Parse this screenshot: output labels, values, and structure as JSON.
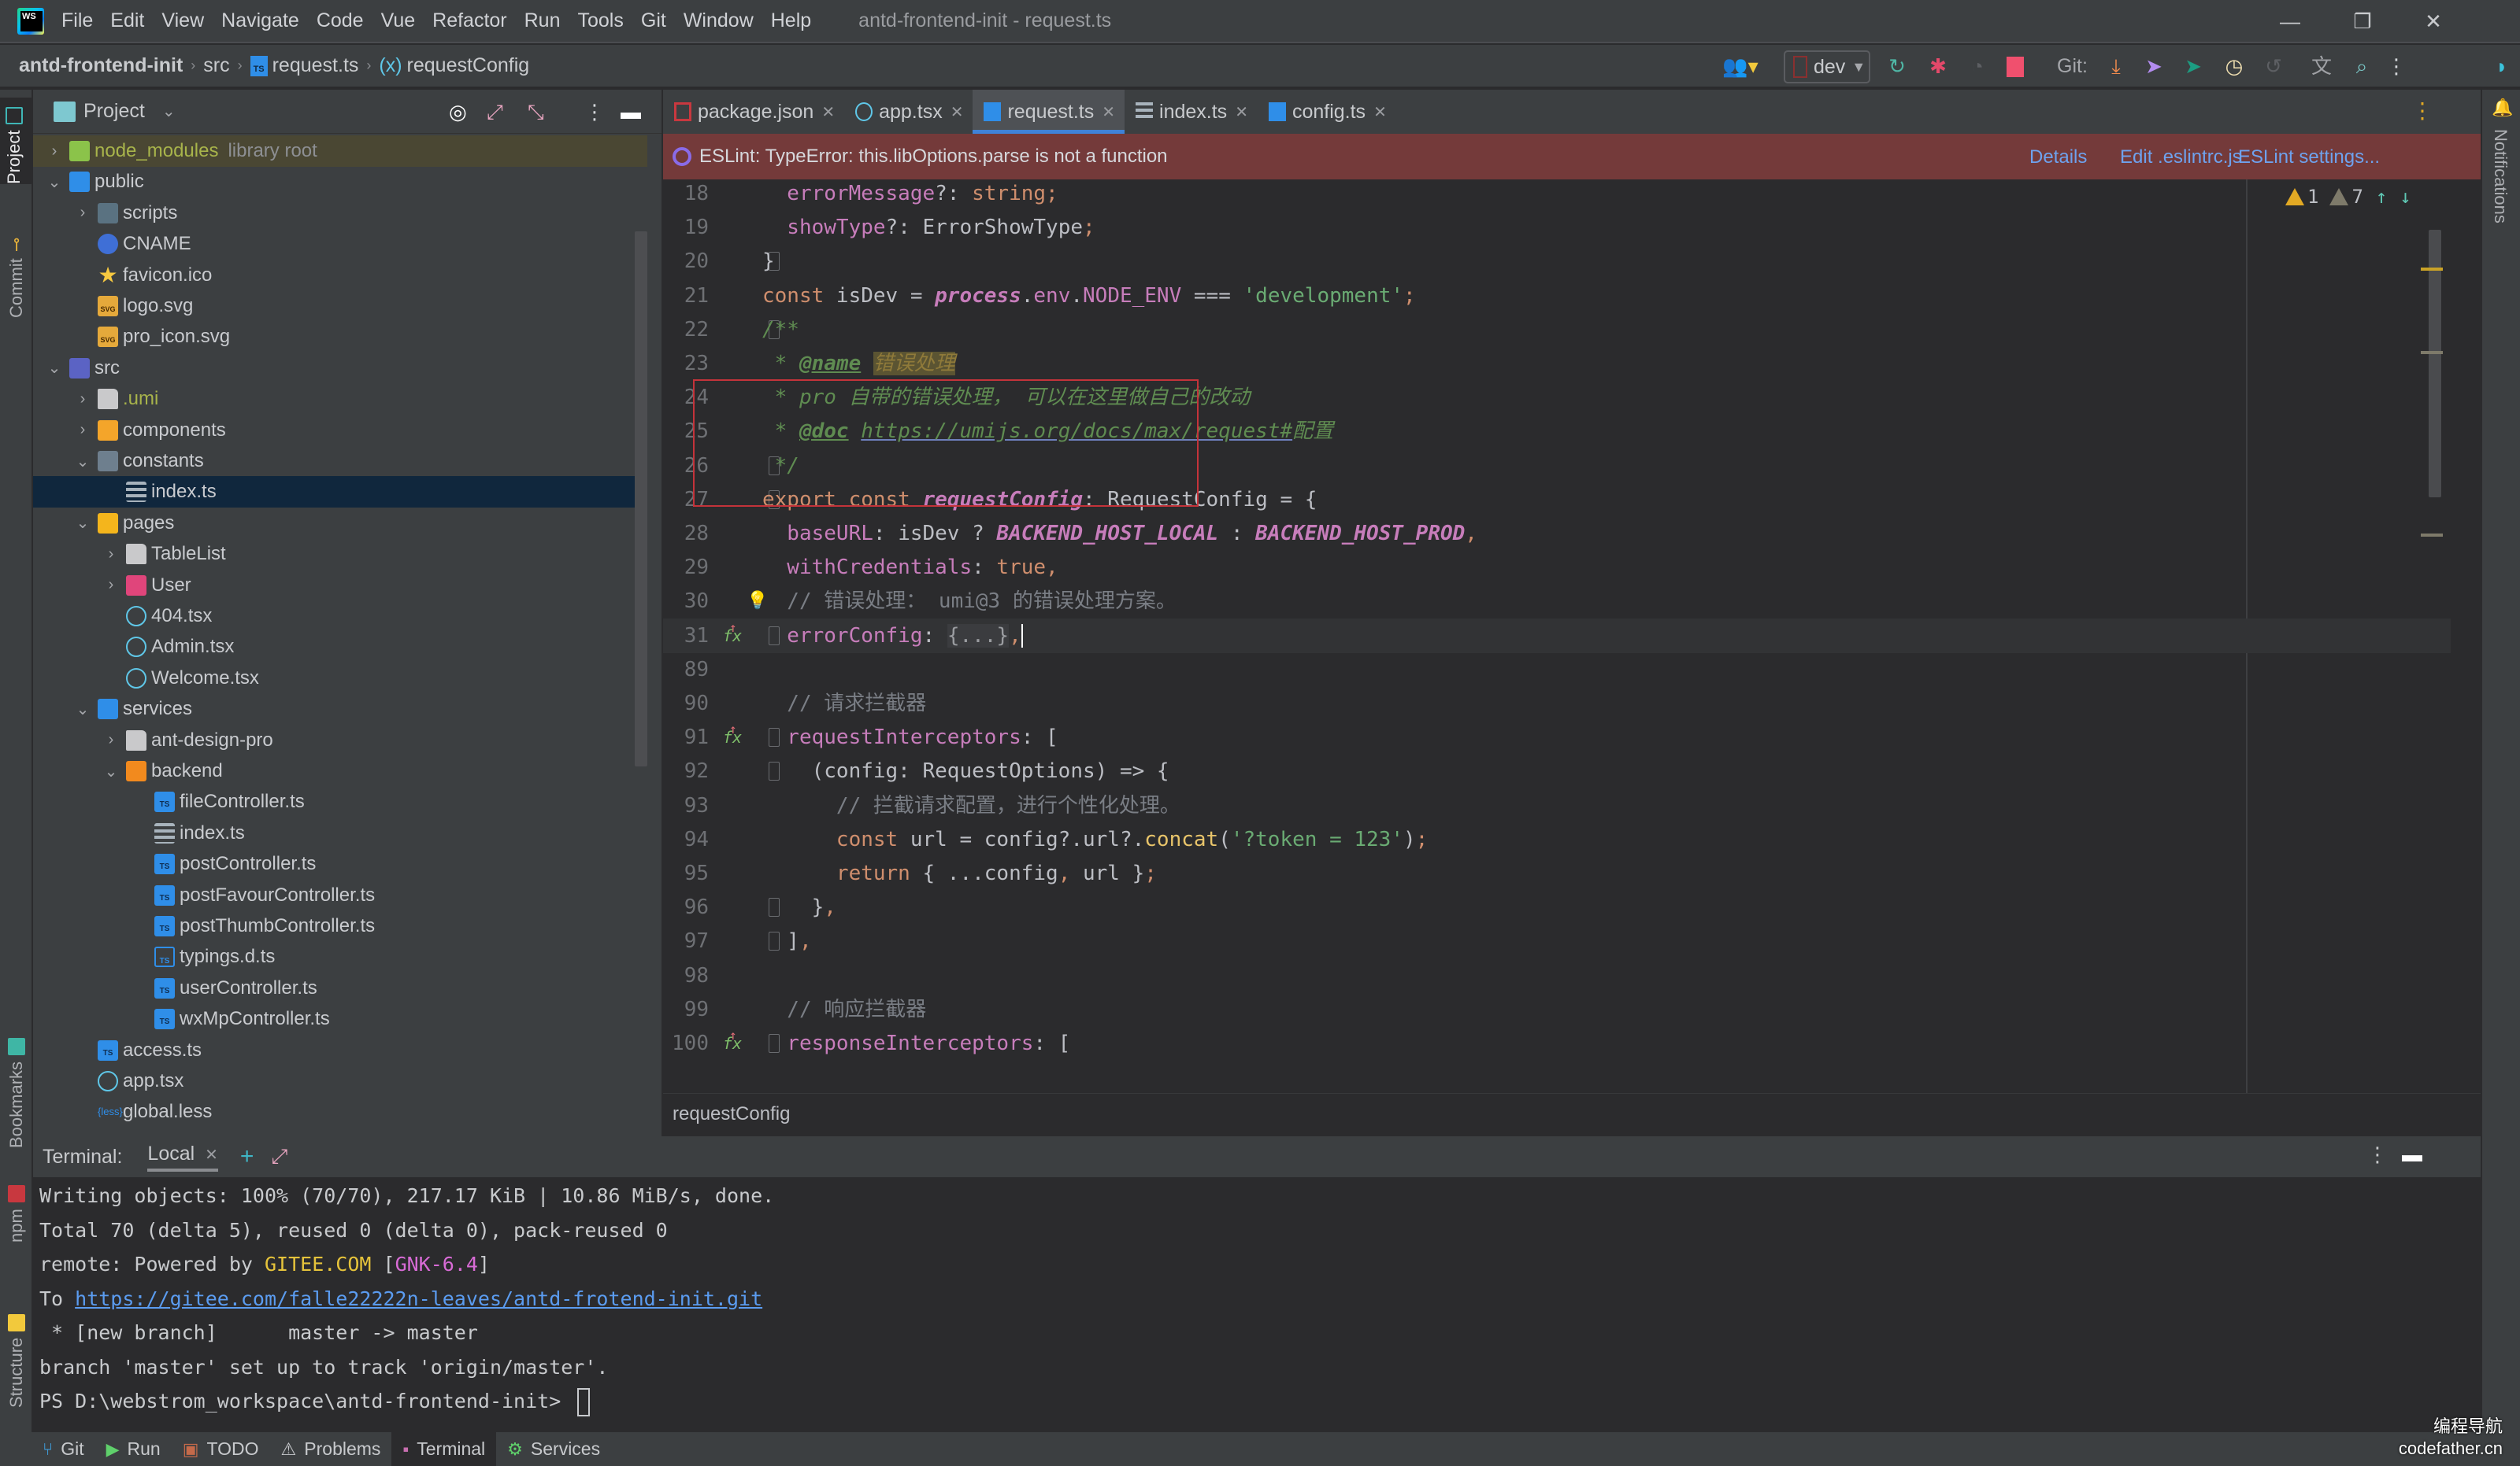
{
  "window": {
    "title": "antd-frontend-init - request.ts",
    "menu": [
      "File",
      "Edit",
      "View",
      "Navigate",
      "Code",
      "Vue",
      "Refactor",
      "Run",
      "Tools",
      "Git",
      "Window",
      "Help"
    ],
    "controls": {
      "minimize": "—",
      "restore": "❐",
      "close": "✕"
    }
  },
  "breadcrumb": {
    "project": "antd-frontend-init",
    "folder": "src",
    "file": "request.ts",
    "symbol_icon": "(x)",
    "symbol": "requestConfig"
  },
  "toolbar": {
    "run_config": "dev",
    "git_label": "Git:",
    "icons": [
      "users-icon",
      "rerun-icon",
      "debug-icon",
      "attach-icon",
      "stop-icon",
      "git-update-icon",
      "git-commit-icon",
      "git-push-icon",
      "history-icon",
      "rollback-icon",
      "translate-icon",
      "search-icon",
      "more-icon",
      "plugin-icon"
    ]
  },
  "left_tools": {
    "project": "Project",
    "commit": "Commit",
    "bookmarks": "Bookmarks",
    "npm": "npm",
    "structure": "Structure"
  },
  "right_tools": {
    "notifications": "Notifications"
  },
  "project_panel": {
    "title": "Project",
    "tree": [
      {
        "label": "node_modules",
        "suffix": "library root",
        "depth": 0,
        "chevron": "›",
        "icon": "f-node",
        "state": "lib"
      },
      {
        "label": "public",
        "depth": 0,
        "chevron": "⌄",
        "icon": "f-public"
      },
      {
        "label": "scripts",
        "depth": 1,
        "chevron": "›",
        "icon": "f-scripts"
      },
      {
        "label": "CNAME",
        "depth": 1,
        "chevron": "",
        "icon": "f-globe"
      },
      {
        "label": "favicon.ico",
        "depth": 1,
        "chevron": "",
        "icon": "f-star"
      },
      {
        "label": "logo.svg",
        "depth": 1,
        "chevron": "",
        "icon": "f-svg"
      },
      {
        "label": "pro_icon.svg",
        "depth": 1,
        "chevron": "",
        "icon": "f-svg"
      },
      {
        "label": "src",
        "depth": 0,
        "chevron": "⌄",
        "icon": "f-src"
      },
      {
        "label": ".umi",
        "depth": 1,
        "chevron": "›",
        "icon": "f-folder",
        "state": "olive"
      },
      {
        "label": "components",
        "depth": 1,
        "chevron": "›",
        "icon": "f-components"
      },
      {
        "label": "constants",
        "depth": 1,
        "chevron": "⌄",
        "icon": "f-constants"
      },
      {
        "label": "index.ts",
        "depth": 2,
        "chevron": "",
        "icon": "f-index",
        "state": "sel"
      },
      {
        "label": "pages",
        "depth": 1,
        "chevron": "⌄",
        "icon": "f-pages"
      },
      {
        "label": "TableList",
        "depth": 2,
        "chevron": "›",
        "icon": "f-folder"
      },
      {
        "label": "User",
        "depth": 2,
        "chevron": "›",
        "icon": "f-user"
      },
      {
        "label": "404.tsx",
        "depth": 2,
        "chevron": "",
        "icon": "f-react"
      },
      {
        "label": "Admin.tsx",
        "depth": 2,
        "chevron": "",
        "icon": "f-react"
      },
      {
        "label": "Welcome.tsx",
        "depth": 2,
        "chevron": "",
        "icon": "f-react"
      },
      {
        "label": "services",
        "depth": 1,
        "chevron": "⌄",
        "icon": "f-services"
      },
      {
        "label": "ant-design-pro",
        "depth": 2,
        "chevron": "›",
        "icon": "f-folder"
      },
      {
        "label": "backend",
        "depth": 2,
        "chevron": "⌄",
        "icon": "f-backend"
      },
      {
        "label": "fileController.ts",
        "depth": 3,
        "chevron": "",
        "icon": "f-ts"
      },
      {
        "label": "index.ts",
        "depth": 3,
        "chevron": "",
        "icon": "f-index"
      },
      {
        "label": "postController.ts",
        "depth": 3,
        "chevron": "",
        "icon": "f-ts"
      },
      {
        "label": "postFavourController.ts",
        "depth": 3,
        "chevron": "",
        "icon": "f-ts"
      },
      {
        "label": "postThumbController.ts",
        "depth": 3,
        "chevron": "",
        "icon": "f-ts"
      },
      {
        "label": "typings.d.ts",
        "depth": 3,
        "chevron": "",
        "icon": "f-dts"
      },
      {
        "label": "userController.ts",
        "depth": 3,
        "chevron": "",
        "icon": "f-ts"
      },
      {
        "label": "wxMpController.ts",
        "depth": 3,
        "chevron": "",
        "icon": "f-ts"
      },
      {
        "label": "access.ts",
        "depth": 1,
        "chevron": "",
        "icon": "f-ts"
      },
      {
        "label": "app.tsx",
        "depth": 1,
        "chevron": "",
        "icon": "f-react"
      },
      {
        "label": "global.less",
        "depth": 1,
        "chevron": "",
        "icon": "f-less"
      }
    ]
  },
  "editor": {
    "tabs": [
      {
        "label": "package.json",
        "icon": "npm-icon",
        "active": false
      },
      {
        "label": "app.tsx",
        "icon": "react-icon",
        "active": false
      },
      {
        "label": "request.ts",
        "icon": "typescript-icon",
        "active": true
      },
      {
        "label": "index.ts",
        "icon": "index-icon",
        "active": false
      },
      {
        "label": "config.ts",
        "icon": "typescript-icon",
        "active": false
      }
    ],
    "banner": {
      "message": "ESLint: TypeError: this.libOptions.parse is not a function",
      "links": [
        "Details",
        "Edit .eslintrc.js",
        "ESLint settings..."
      ]
    },
    "inspections": {
      "warnings": "1",
      "weak_warnings": "7"
    },
    "lines": [
      {
        "n": "18",
        "tokens": [
          [
            "prop",
            "  errorMessage"
          ],
          [
            "plain",
            "?: "
          ],
          [
            "kw",
            "string"
          ],
          [
            "punc",
            ";"
          ]
        ]
      },
      {
        "n": "19",
        "tokens": [
          [
            "prop",
            "  showType"
          ],
          [
            "plain",
            "?: ErrorShowType"
          ],
          [
            "punc",
            ";"
          ]
        ],
        "fold": false
      },
      {
        "n": "20",
        "tokens": [
          [
            "plain",
            "}"
          ]
        ],
        "fold": true
      },
      {
        "n": "21",
        "tokens": [
          [
            "kw",
            "const "
          ],
          [
            "plain",
            "isDev = "
          ],
          [
            "procit",
            "process"
          ],
          [
            "plain",
            "."
          ],
          [
            "prop",
            "env"
          ],
          [
            "plain",
            "."
          ],
          [
            "prop",
            "NODE_ENV"
          ],
          [
            "plain",
            " === "
          ],
          [
            "str",
            "'development'"
          ],
          [
            "punc",
            ";"
          ]
        ]
      },
      {
        "n": "22",
        "tokens": [
          [
            "doccmt",
            "/**"
          ]
        ],
        "fold": true
      },
      {
        "n": "23",
        "tokens": [
          [
            "doccmt",
            " * "
          ],
          [
            "doctag",
            "@name"
          ],
          [
            "plain",
            " "
          ],
          [
            "docname",
            "错误处理"
          ]
        ]
      },
      {
        "n": "24",
        "tokens": [
          [
            "doccmt",
            " * pro 自带的错误处理， 可以在这里做自己的改动"
          ]
        ]
      },
      {
        "n": "25",
        "tokens": [
          [
            "doccmt",
            " * "
          ],
          [
            "doctag",
            "@doc"
          ],
          [
            "plain",
            " "
          ],
          [
            "link",
            "https://umijs.org/docs/max/request#"
          ],
          [
            "doccmt",
            "配置"
          ]
        ]
      },
      {
        "n": "26",
        "tokens": [
          [
            "doccmt",
            " */"
          ]
        ],
        "fold": true
      },
      {
        "n": "27",
        "tokens": [
          [
            "kw",
            "export const "
          ],
          [
            "italicdecl",
            "requestConfig"
          ],
          [
            "plain",
            ": RequestConfig = {"
          ]
        ],
        "fold": true
      },
      {
        "n": "28",
        "tokens": [
          [
            "prop",
            "  baseURL"
          ],
          [
            "plain",
            ": isDev ? "
          ],
          [
            "constit",
            "BACKEND_HOST_LOCAL"
          ],
          [
            "plain",
            " : "
          ],
          [
            "constit",
            "BACKEND_HOST_PROD"
          ],
          [
            "punc",
            ","
          ]
        ]
      },
      {
        "n": "29",
        "tokens": [
          [
            "prop",
            "  withCredentials"
          ],
          [
            "plain",
            ": "
          ],
          [
            "kw",
            "true"
          ],
          [
            "punc",
            ","
          ]
        ]
      },
      {
        "n": "30",
        "tokens": [
          [
            "cmt",
            "  // 错误处理： umi@3 的错误处理方案。"
          ]
        ],
        "bulb": true
      },
      {
        "n": "31",
        "tokens": [
          [
            "prop",
            "  errorConfig"
          ],
          [
            "plain",
            ": "
          ],
          [
            "folded",
            "{...}"
          ],
          [
            "punc",
            ","
          ]
        ],
        "current": true,
        "fx": true,
        "fold": true
      },
      {
        "n": "89",
        "tokens": []
      },
      {
        "n": "90",
        "tokens": [
          [
            "cmt",
            "  // 请求拦截器"
          ]
        ]
      },
      {
        "n": "91",
        "tokens": [
          [
            "prop",
            "  requestInterceptors"
          ],
          [
            "plain",
            ": ["
          ]
        ],
        "fx": true,
        "fold": true
      },
      {
        "n": "92",
        "tokens": [
          [
            "plain",
            "    (config: RequestOptions) => {"
          ]
        ],
        "fold": true
      },
      {
        "n": "93",
        "tokens": [
          [
            "cmt",
            "      // 拦截请求配置，进行个性化处理。"
          ]
        ]
      },
      {
        "n": "94",
        "tokens": [
          [
            "kw",
            "      const "
          ],
          [
            "plain",
            "url = config?.url?."
          ],
          [
            "fnyel",
            "concat"
          ],
          [
            "plain",
            "("
          ],
          [
            "str",
            "'?token = 123'"
          ],
          [
            "plain",
            ")"
          ],
          [
            "punc",
            ";"
          ]
        ]
      },
      {
        "n": "95",
        "tokens": [
          [
            "kw",
            "      return "
          ],
          [
            "plain",
            "{ ...config"
          ],
          [
            "punc",
            ","
          ],
          [
            "plain",
            " url }"
          ],
          [
            "punc",
            ";"
          ]
        ]
      },
      {
        "n": "96",
        "tokens": [
          [
            "plain",
            "    }"
          ],
          [
            "punc",
            ","
          ]
        ],
        "fold": true
      },
      {
        "n": "97",
        "tokens": [
          [
            "plain",
            "  ]"
          ],
          [
            "punc",
            ","
          ]
        ],
        "fold": true
      },
      {
        "n": "98",
        "tokens": []
      },
      {
        "n": "99",
        "tokens": [
          [
            "cmt",
            "  // 响应拦截器"
          ]
        ]
      },
      {
        "n": "100",
        "tokens": [
          [
            "prop",
            "  responseInterceptors"
          ],
          [
            "plain",
            ": ["
          ]
        ],
        "fx": true,
        "fold": true
      }
    ],
    "footer_crumb": "requestConfig"
  },
  "terminal": {
    "label": "Terminal:",
    "tab": "Local",
    "lines": [
      [
        [
          "n",
          "Writing objects: 100% (70/70), 217.17 KiB | 10.86 MiB/s, done."
        ]
      ],
      [
        [
          "n",
          "Total 70 (delta 5), reused 0 (delta 0), pack-reused 0"
        ]
      ],
      [
        [
          "n",
          "remote: Powered by "
        ],
        [
          "y",
          "GITEE.COM"
        ],
        [
          "n",
          " ["
        ],
        [
          "p",
          "GNK-6.4"
        ],
        [
          "n",
          "]"
        ]
      ],
      [
        [
          "n",
          "To "
        ],
        [
          "l",
          "https://gitee.com/falle22222n-leaves/antd-frotend-init.git"
        ]
      ],
      [
        [
          "n",
          " * [new branch]      master -> master"
        ]
      ],
      [
        [
          "n",
          "branch 'master' set up to track 'origin/master'."
        ]
      ],
      [
        [
          "n",
          "PS D:\\webstrom_workspace\\antd-frontend-init> "
        ],
        [
          "c",
          ""
        ]
      ]
    ]
  },
  "bottom_tools": [
    {
      "label": "Git",
      "icon": "git-branch-icon",
      "active": false
    },
    {
      "label": "Run",
      "icon": "run-icon",
      "active": false
    },
    {
      "label": "TODO",
      "icon": "todo-icon",
      "active": false
    },
    {
      "label": "Problems",
      "icon": "problems-icon",
      "active": false
    },
    {
      "label": "Terminal",
      "icon": "terminal-icon",
      "active": true
    },
    {
      "label": "Services",
      "icon": "services-icon",
      "active": false
    }
  ],
  "watermark": {
    "line1": "编程导航",
    "line2": "codefather.cn"
  }
}
